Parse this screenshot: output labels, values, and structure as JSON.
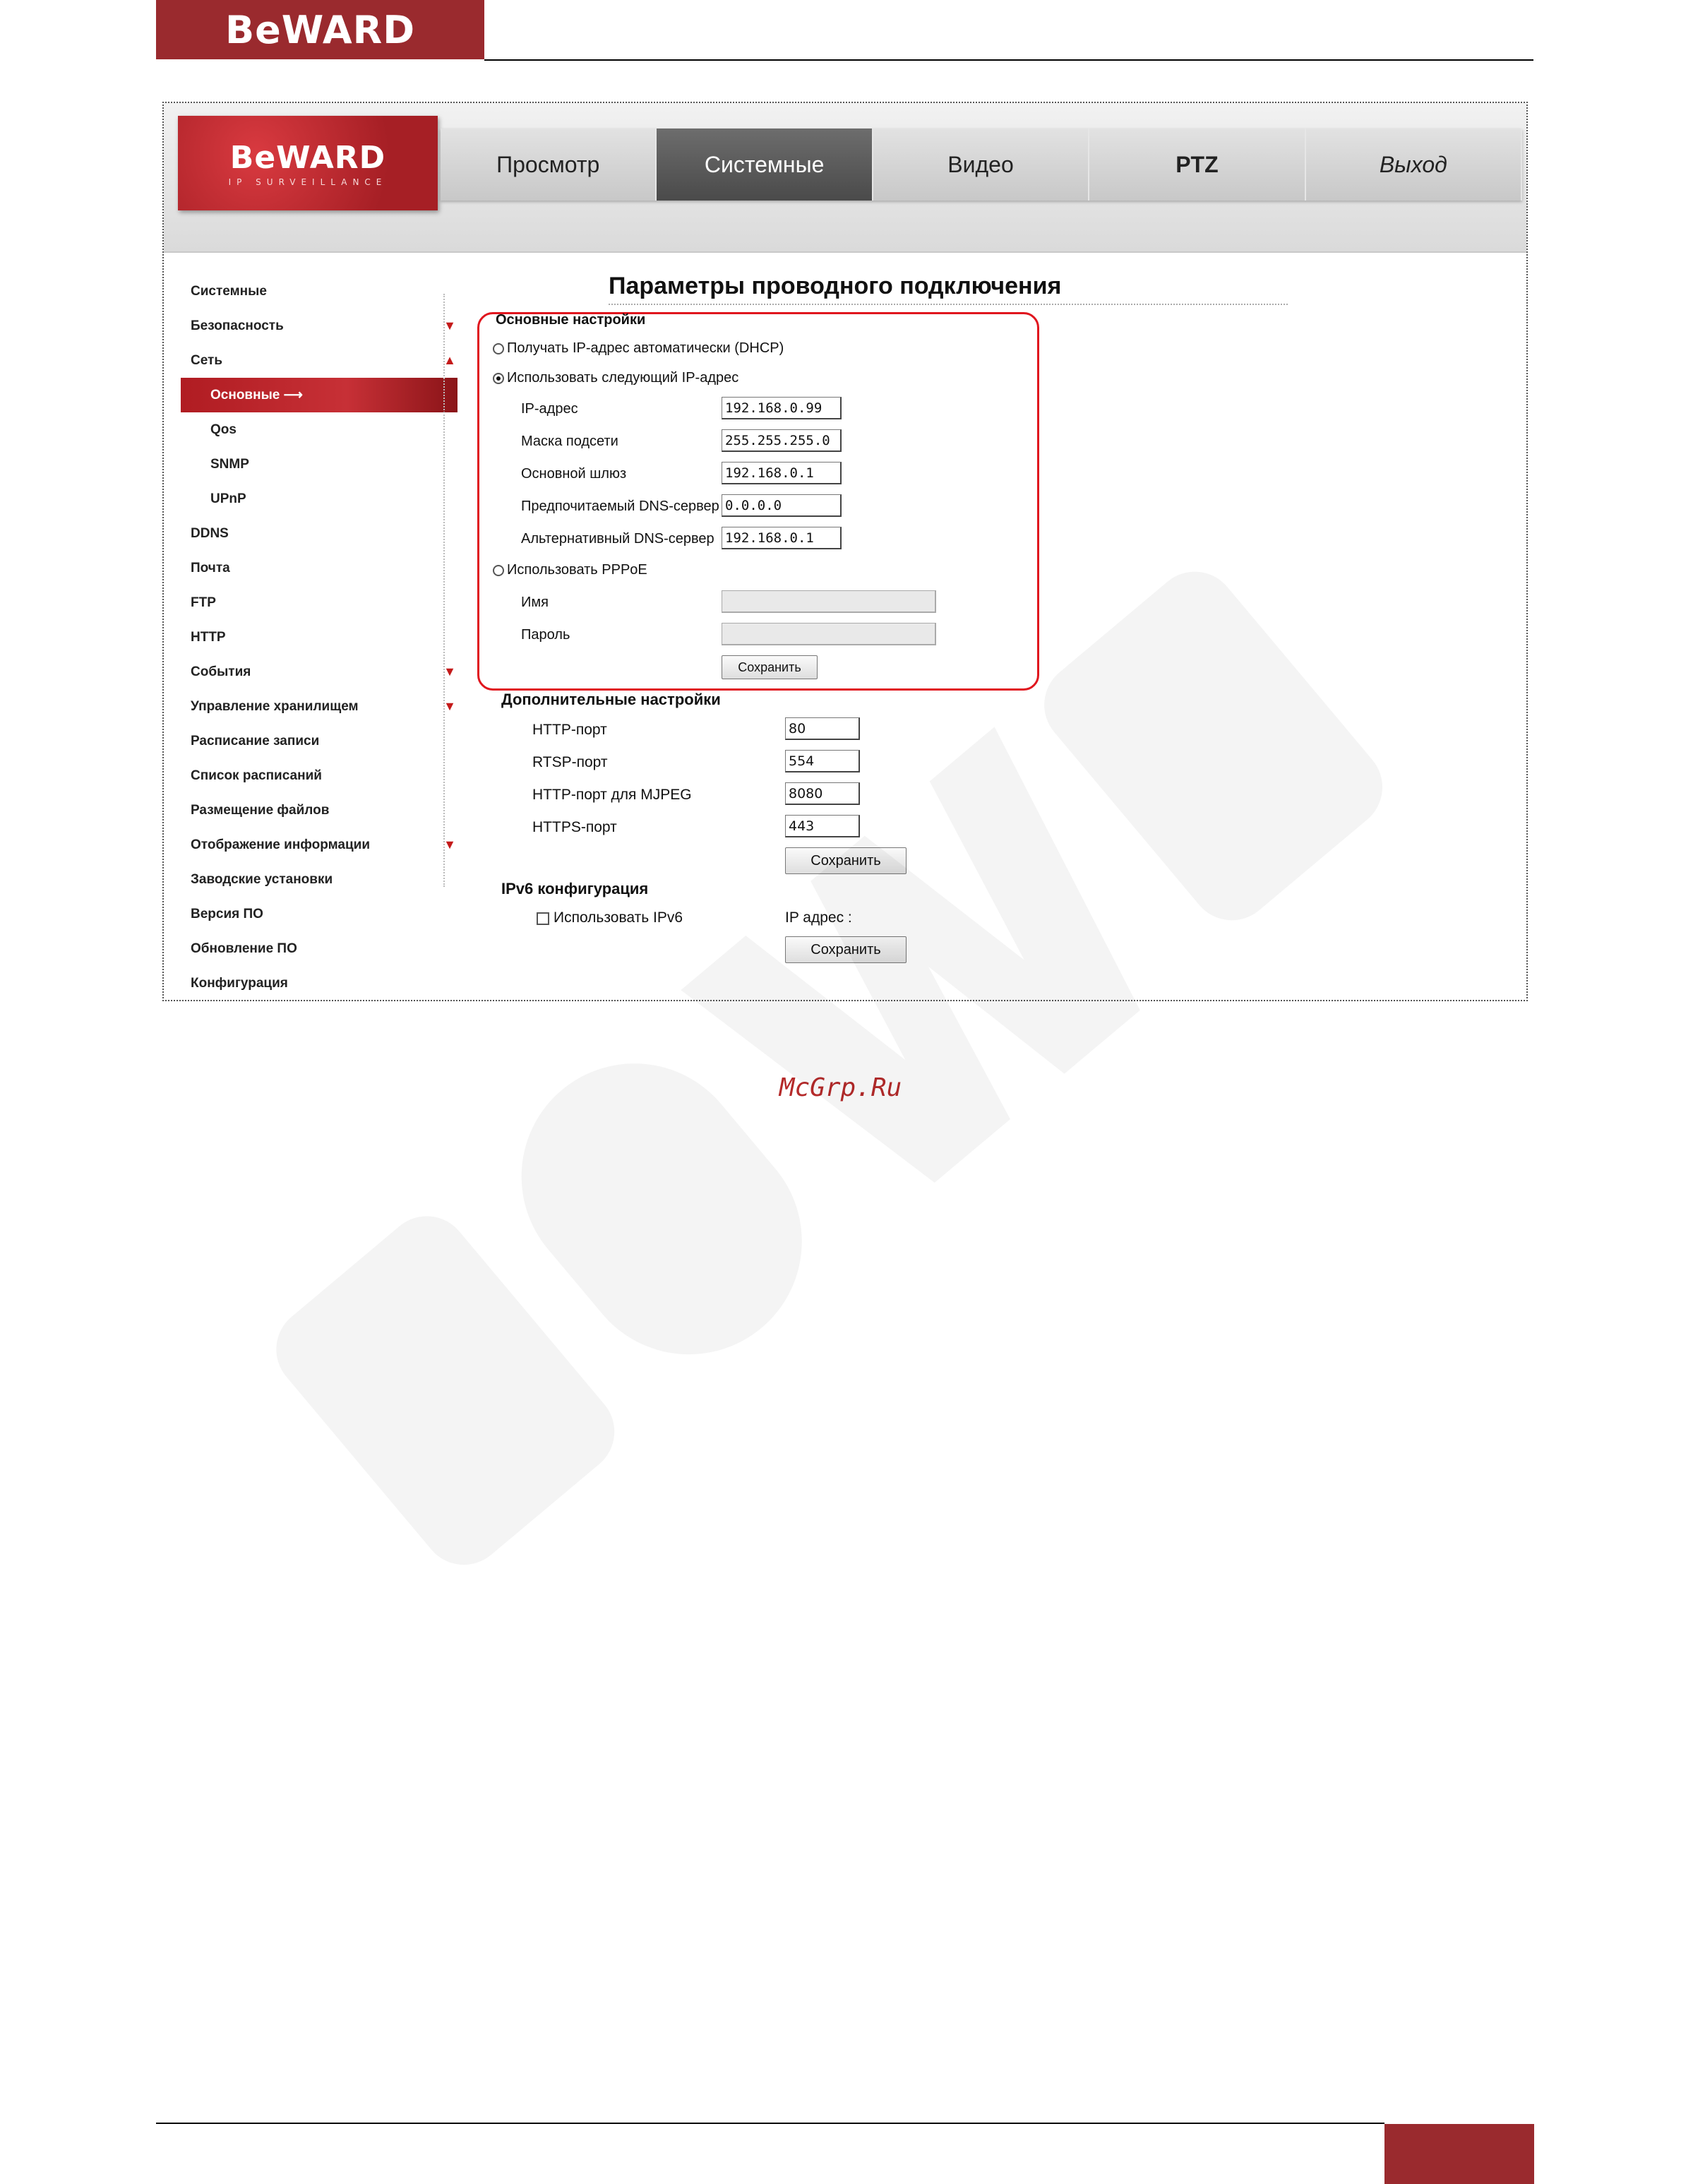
{
  "doc": {
    "header_logo": "BeWARD",
    "watermark_url": "McGrp.Ru"
  },
  "camera_ui": {
    "logo": {
      "brand": "BeWARD",
      "tagline": "IP SURVEILLANCE"
    },
    "nav": {
      "tabs": [
        {
          "label": "Просмотр"
        },
        {
          "label": "Системные"
        },
        {
          "label": "Видео"
        },
        {
          "label": "PTZ"
        },
        {
          "label": "Выход"
        }
      ],
      "active_tab": "Системные"
    },
    "sidebar": {
      "items": [
        {
          "label": "Системные"
        },
        {
          "label": "Безопасность",
          "arrow": "▼"
        },
        {
          "label": "Сеть",
          "arrow": "▲"
        },
        {
          "label": "Основные",
          "sub": true,
          "active": true,
          "pointer": "⟶"
        },
        {
          "label": "Qos",
          "sub": true
        },
        {
          "label": "SNMP",
          "sub": true
        },
        {
          "label": "UPnP",
          "sub": true
        },
        {
          "label": "DDNS"
        },
        {
          "label": "Почта"
        },
        {
          "label": "FTP"
        },
        {
          "label": "HTTP"
        },
        {
          "label": "События",
          "arrow": "▼"
        },
        {
          "label": "Управление хранилищем",
          "arrow": "▼"
        },
        {
          "label": "Расписание записи"
        },
        {
          "label": "Список расписаний"
        },
        {
          "label": "Размещение файлов"
        },
        {
          "label": "Отображение информации",
          "arrow": "▼"
        },
        {
          "label": "Заводские установки"
        },
        {
          "label": "Версия ПО"
        },
        {
          "label": "Обновление ПО"
        },
        {
          "label": "Конфигурация"
        }
      ]
    },
    "page_title": "Параметры проводного подключения",
    "basic": {
      "heading": "Основные настройки",
      "radio_dhcp": "Получать IP-адрес автоматически (DHCP)",
      "radio_static": "Использовать следующий IP-адрес",
      "radio_pppoe": "Использовать PPPoE",
      "selected": "static",
      "ip_label": "IP-адрес",
      "ip_value": "192.168.0.99",
      "mask_label": "Маска подсети",
      "mask_value": "255.255.255.0",
      "gateway_label": "Основной шлюз",
      "gateway_value": "192.168.0.1",
      "dns1_label": "Предпочитаемый DNS-сервер",
      "dns1_value": "0.0.0.0",
      "dns2_label": "Альтернативный DNS-сервер",
      "dns2_value": "192.168.0.1",
      "name_label": "Имя",
      "name_value": "",
      "password_label": "Пароль",
      "password_value": "",
      "save_label": "Сохранить"
    },
    "advanced": {
      "heading": "Дополнительные настройки",
      "http_label": "HTTP-порт",
      "http_value": "80",
      "rtsp_label": "RTSP-порт",
      "rtsp_value": "554",
      "mjpeg_label": "HTTP-порт для MJPEG",
      "mjpeg_value": "8080",
      "https_label": "HTTPS-порт",
      "https_value": "443",
      "save_label": "Сохранить"
    },
    "ipv6": {
      "heading": "IPv6 конфигурация",
      "use_label": "Использовать IPv6",
      "checked": false,
      "ip_label": "IP адрес :",
      "save_label": "Сохранить"
    }
  }
}
